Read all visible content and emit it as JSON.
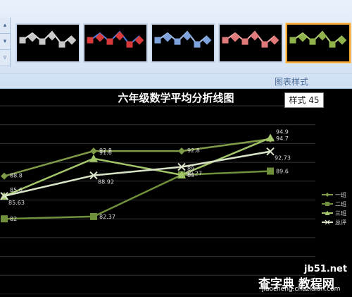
{
  "ribbon": {
    "group_label": "图表样式",
    "left_controls": [
      "▴",
      "▾",
      "▿"
    ],
    "styles": [
      {
        "name": "style-41",
        "color": "#c8c8c8",
        "line": "#e6e6e6"
      },
      {
        "name": "style-42",
        "color": "#d63a3a",
        "line": "#4a7de0"
      },
      {
        "name": "style-43",
        "color": "#7da2dc",
        "line": "#a7c1ec"
      },
      {
        "name": "style-44",
        "color": "#e07a7a",
        "line": "#f0a8a8"
      },
      {
        "name": "style-45",
        "color": "#8fb34a",
        "line": "#b9d37a",
        "selected": true
      }
    ]
  },
  "tooltip": {
    "text": "样式 45"
  },
  "chart_data": {
    "type": "line",
    "title": "六年级数学平均分折线图",
    "x": [
      "1",
      "2",
      "3",
      "4"
    ],
    "ylim": [
      70,
      100
    ],
    "series": [
      {
        "name": "一班",
        "values": [
          88.8,
          92.8,
          92.8,
          94.7
        ],
        "labels": [
          "88.8",
          "92.8",
          "92.8",
          "94.7"
        ],
        "color": "#7f9a48",
        "marker": "diamond"
      },
      {
        "name": "二班",
        "values": [
          82,
          82.37,
          89,
          89.6
        ],
        "labels": [
          "82",
          "82.37",
          "89",
          "89.6"
        ],
        "color": "#6f8f3a",
        "marker": "square"
      },
      {
        "name": "三班",
        "values": [
          85.6,
          91.6,
          89,
          94.9
        ],
        "labels": [
          "85.6",
          "91.6",
          "89",
          "94.9"
        ],
        "color": "#a3c56a",
        "marker": "triangle"
      },
      {
        "name": "总评",
        "values": [
          85.63,
          88.92,
          90.27,
          92.73
        ],
        "labels": [
          "85.63",
          "88.92",
          "90.27",
          "92.73"
        ],
        "color": "#d8e3c8",
        "marker": "x"
      }
    ],
    "legend": "right"
  },
  "watermark": {
    "line1": "jb51.net",
    "line2": "查字典 教程网",
    "line3": "jiaocheng.chazidian.com"
  }
}
